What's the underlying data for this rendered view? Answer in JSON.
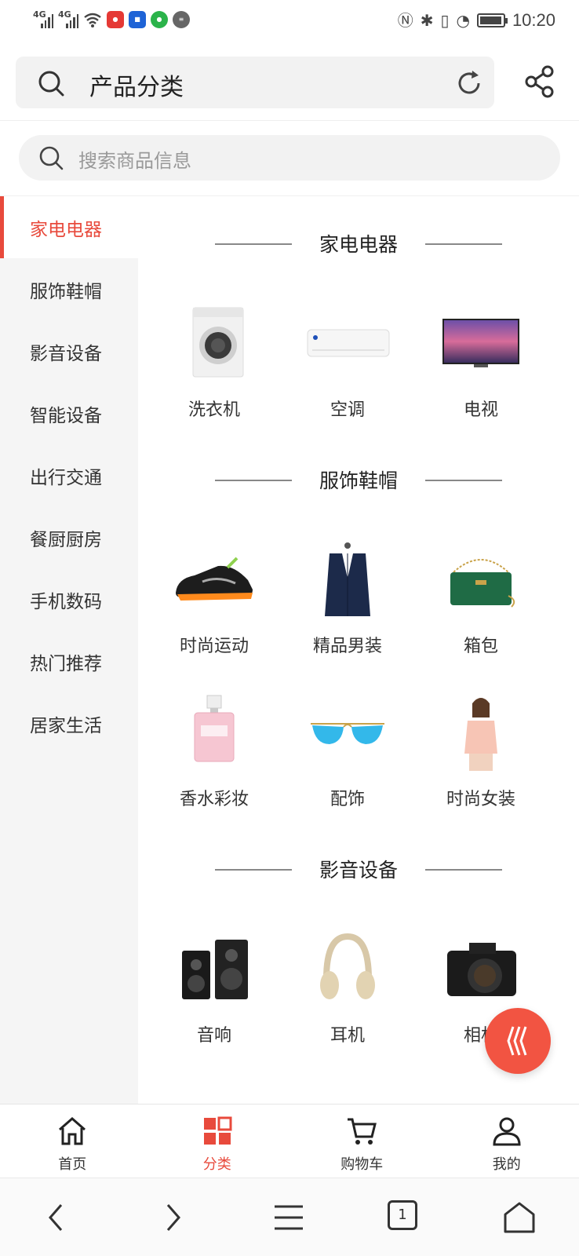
{
  "status_bar": {
    "time": "10:20",
    "network_1": "4G",
    "network_2": "4G",
    "battery_level": 0.95
  },
  "browser": {
    "title": "产品分类"
  },
  "search": {
    "placeholder": "搜索商品信息"
  },
  "sidebar": {
    "items": [
      {
        "label": "家电电器",
        "active": true
      },
      {
        "label": "服饰鞋帽"
      },
      {
        "label": "影音设备"
      },
      {
        "label": "智能设备"
      },
      {
        "label": "出行交通"
      },
      {
        "label": "餐厨厨房"
      },
      {
        "label": "手机数码"
      },
      {
        "label": "热门推荐"
      },
      {
        "label": "居家生活"
      }
    ]
  },
  "sections": [
    {
      "title": "家电电器",
      "products": [
        {
          "name": "洗衣机",
          "icon": "washing-machine"
        },
        {
          "name": "空调",
          "icon": "air-conditioner"
        },
        {
          "name": "电视",
          "icon": "television"
        }
      ]
    },
    {
      "title": "服饰鞋帽",
      "products": [
        {
          "name": "时尚运动",
          "icon": "sneaker"
        },
        {
          "name": "精品男装",
          "icon": "mens-suit"
        },
        {
          "name": "箱包",
          "icon": "handbag"
        },
        {
          "name": "香水彩妆",
          "icon": "perfume"
        },
        {
          "name": "配饰",
          "icon": "sunglasses"
        },
        {
          "name": "时尚女装",
          "icon": "womens-fashion"
        }
      ]
    },
    {
      "title": "影音设备",
      "products": [
        {
          "name": "音响",
          "icon": "speakers"
        },
        {
          "name": "耳机",
          "icon": "headphones"
        },
        {
          "name": "相机",
          "icon": "camera"
        }
      ]
    }
  ],
  "tabbar": {
    "items": [
      {
        "label": "首页",
        "icon": "home-icon"
      },
      {
        "label": "分类",
        "icon": "category-icon",
        "active": true
      },
      {
        "label": "购物车",
        "icon": "cart-icon"
      },
      {
        "label": "我的",
        "icon": "user-icon"
      }
    ]
  },
  "browser_nav": {
    "tab_count": "1"
  },
  "colors": {
    "accent": "#e84a3c",
    "fab": "#f25442",
    "sidebar_bg": "#f5f5f5"
  }
}
